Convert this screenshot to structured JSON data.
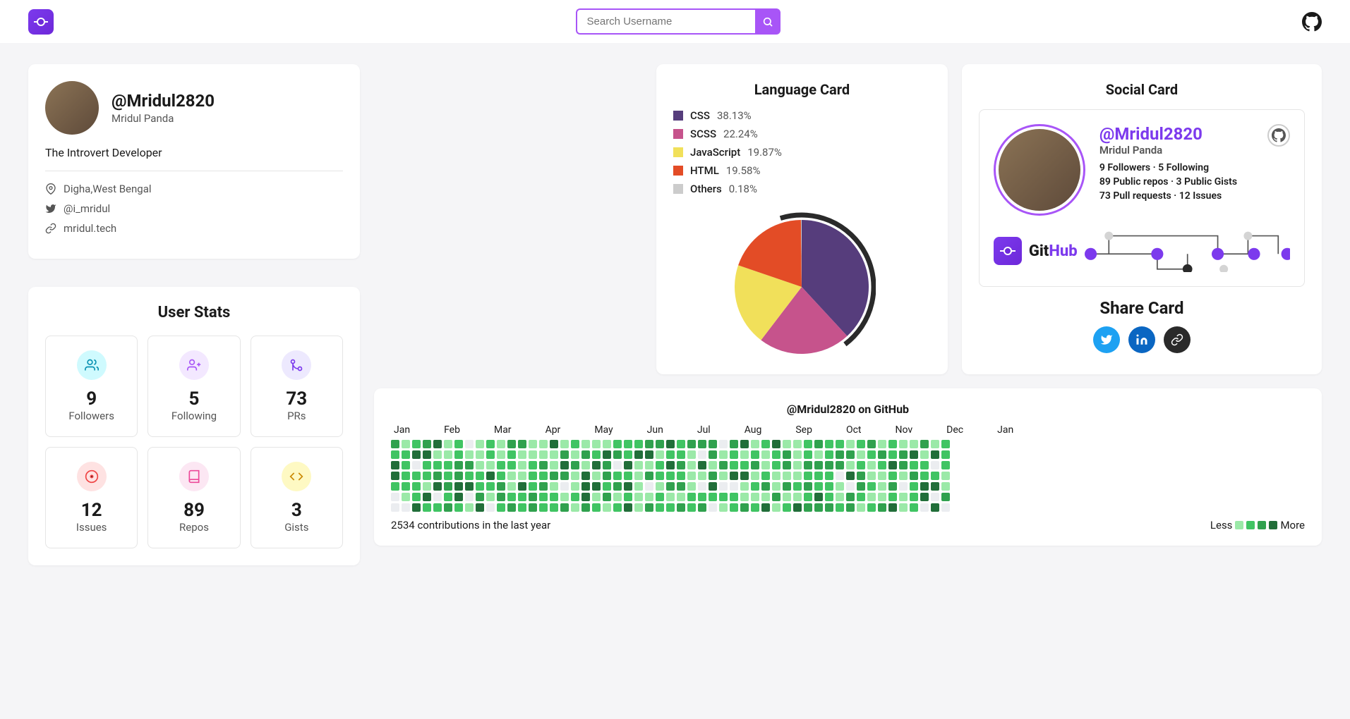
{
  "search": {
    "placeholder": "Search Username"
  },
  "profile": {
    "username": "@Mridul2820",
    "fullname": "Mridul Panda",
    "bio": "The Introvert Developer",
    "location": "Digha,West Bengal",
    "twitter": "@i_mridul",
    "website": "mridul.tech"
  },
  "stats": {
    "title": "User Stats",
    "items": [
      {
        "value": "9",
        "label": "Followers",
        "bg": "#cffafe",
        "fg": "#0891b2"
      },
      {
        "value": "5",
        "label": "Following",
        "bg": "#f3e8ff",
        "fg": "#a855f7"
      },
      {
        "value": "73",
        "label": "PRs",
        "bg": "#ede9fe",
        "fg": "#7c3aed"
      },
      {
        "value": "12",
        "label": "Issues",
        "bg": "#fee2e2",
        "fg": "#ef4444"
      },
      {
        "value": "89",
        "label": "Repos",
        "bg": "#fce7f3",
        "fg": "#ec4899"
      },
      {
        "value": "3",
        "label": "Gists",
        "bg": "#fef9c3",
        "fg": "#ca8a04"
      }
    ]
  },
  "lang": {
    "title": "Language Card",
    "items": [
      {
        "name": "CSS",
        "pct": "38.13%",
        "color": "#563d7c"
      },
      {
        "name": "SCSS",
        "pct": "22.24%",
        "color": "#c6538c"
      },
      {
        "name": "JavaScript",
        "pct": "19.87%",
        "color": "#f1e05a"
      },
      {
        "name": "HTML",
        "pct": "19.58%",
        "color": "#e34c26"
      },
      {
        "name": "Others",
        "pct": "0.18%",
        "color": "#cccccc"
      }
    ]
  },
  "social": {
    "title": "Social Card",
    "username": "@Mridul2820",
    "fullname": "Mridul Panda",
    "line1": "9 Followers  ·  5 Following",
    "line2": "89 Public repos  ·  3 Public Gists",
    "line3": "73 Pull requests  ·  12 Issues",
    "github_git": "Git",
    "github_hub": "Hub",
    "share_title": "Share Card"
  },
  "contrib": {
    "title": "@Mridul2820 on GitHub",
    "months": [
      "Jan",
      "Feb",
      "Mar",
      "Apr",
      "May",
      "Jun",
      "Jul",
      "Aug",
      "Sep",
      "Oct",
      "Nov",
      "Dec",
      "Jan"
    ],
    "total": "2534 contributions in the last year",
    "less": "Less",
    "more": "More"
  },
  "chart_data": {
    "type": "pie",
    "title": "Language Card",
    "series": [
      {
        "name": "CSS",
        "value": 38.13,
        "color": "#563d7c"
      },
      {
        "name": "SCSS",
        "value": 22.24,
        "color": "#c6538c"
      },
      {
        "name": "JavaScript",
        "value": 19.87,
        "color": "#f1e05a"
      },
      {
        "name": "HTML",
        "value": 19.58,
        "color": "#e34c26"
      },
      {
        "name": "Others",
        "value": 0.18,
        "color": "#cccccc"
      }
    ]
  }
}
